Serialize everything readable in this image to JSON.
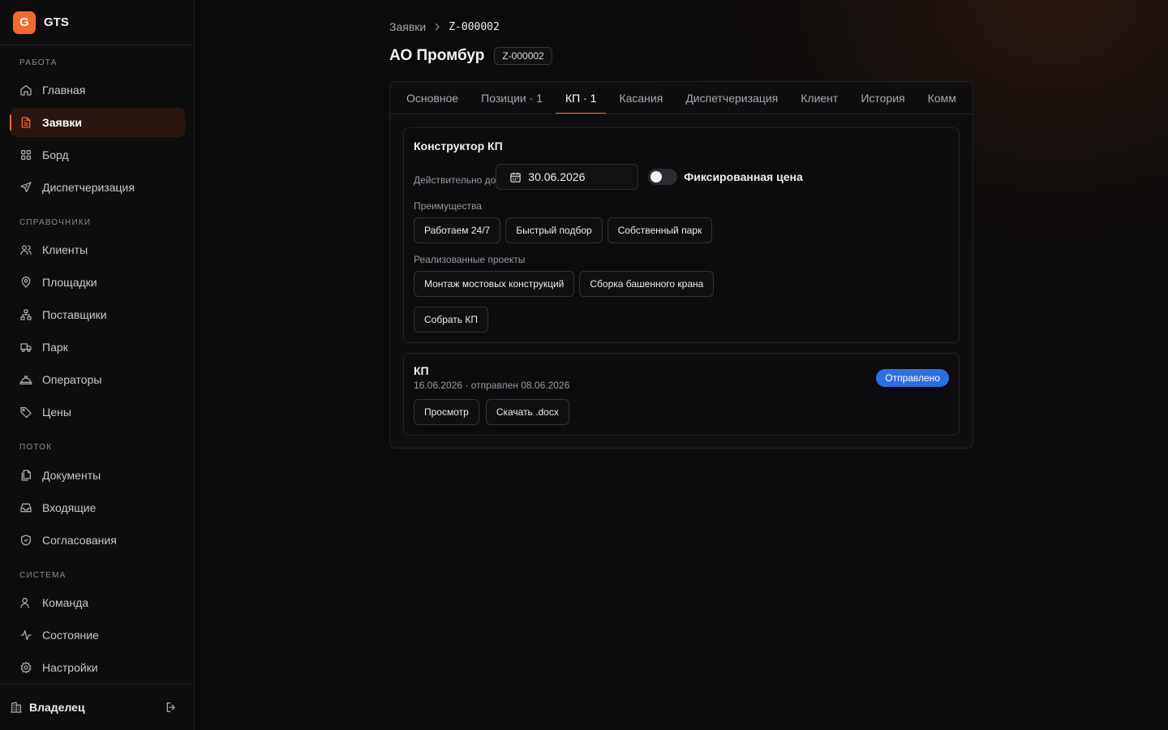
{
  "brand": {
    "logo_letter": "G",
    "name": "GTS"
  },
  "sidebar": {
    "sections": [
      {
        "title": "РАБОТА",
        "items": [
          {
            "label": "Главная",
            "icon": "home-icon"
          },
          {
            "label": "Заявки",
            "icon": "document-icon",
            "active": true
          },
          {
            "label": "Борд",
            "icon": "grid-icon"
          },
          {
            "label": "Диспетчеризация",
            "icon": "send-icon"
          }
        ]
      },
      {
        "title": "СПРАВОЧНИКИ",
        "items": [
          {
            "label": "Клиенты",
            "icon": "users-icon"
          },
          {
            "label": "Площадки",
            "icon": "map-pin-icon"
          },
          {
            "label": "Поставщики",
            "icon": "network-icon"
          },
          {
            "label": "Парк",
            "icon": "truck-icon"
          },
          {
            "label": "Операторы",
            "icon": "hard-hat-icon"
          },
          {
            "label": "Цены",
            "icon": "tag-icon"
          }
        ]
      },
      {
        "title": "ПОТОК",
        "items": [
          {
            "label": "Документы",
            "icon": "files-icon"
          },
          {
            "label": "Входящие",
            "icon": "inbox-icon"
          },
          {
            "label": "Согласования",
            "icon": "shield-check-icon"
          }
        ]
      },
      {
        "title": "СИСТЕМА",
        "items": [
          {
            "label": "Команда",
            "icon": "user-icon"
          },
          {
            "label": "Состояние",
            "icon": "activity-icon"
          },
          {
            "label": "Настройки",
            "icon": "gear-icon"
          }
        ]
      }
    ],
    "footer": {
      "user": "Владелец",
      "user_icon": "building-icon",
      "logout_icon": "logout-icon"
    }
  },
  "breadcrumb": {
    "parent": "Заявки",
    "current": "Z-000002"
  },
  "page": {
    "title": "АО Промбур",
    "id_badge": "Z-000002"
  },
  "tabs": [
    {
      "label": "Основное"
    },
    {
      "label": "Позиции · 1"
    },
    {
      "label": "КП · 1",
      "active": true
    },
    {
      "label": "Касания"
    },
    {
      "label": "Диспетчеризация"
    },
    {
      "label": "Клиент"
    },
    {
      "label": "История"
    },
    {
      "label": "Комм"
    }
  ],
  "builder": {
    "title": "Конструктор КП",
    "valid_until_label": "Действительно до",
    "valid_until_value": "30.06.2026",
    "fixed_price_label": "Фиксированная цена",
    "fixed_price_on": false,
    "advantages_label": "Преимущества",
    "advantages": [
      "Работаем 24/7",
      "Быстрый подбор",
      "Собственный парк"
    ],
    "projects_label": "Реализованные проекты",
    "projects": [
      "Монтаж мостовых конструкций",
      "Сборка башенного крана"
    ],
    "build_button": "Собрать КП"
  },
  "kp": {
    "title": "КП",
    "meta": "16.06.2026 · отправлен 08.06.2026",
    "status": "Отправлено",
    "status_color": "#2d6fe0",
    "view_button": "Просмотр",
    "download_button": "Скачать .docx"
  },
  "colors": {
    "accent": "#f26a2e",
    "background": "#0b0b0c"
  }
}
